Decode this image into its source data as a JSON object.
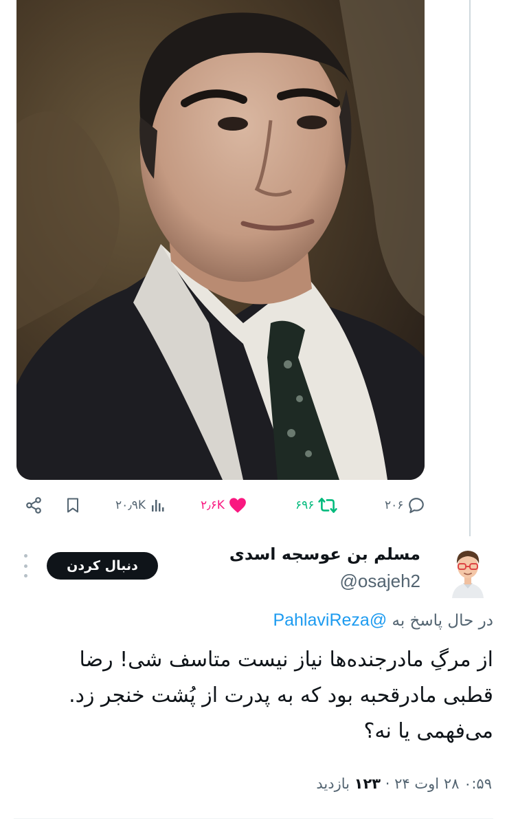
{
  "media": {
    "photo_icon": "portrait-photo"
  },
  "actions": {
    "reply_count": "۲۰۶",
    "retweet_count": "۶۹۶",
    "like_count": "۲٫۶K",
    "views_count": "۲۰٫۹K",
    "icons": [
      "reply-icon",
      "retweet-icon",
      "heart-icon",
      "views-icon",
      "bookmark-icon",
      "share-icon"
    ],
    "colors": {
      "default": "#536471",
      "like": "#f91880",
      "retweet": "#00ba7c"
    }
  },
  "reply": {
    "display_name": "مسلم بن عوسجه اسدی",
    "handle": "@osajeh2",
    "follow_label": "دنبال کردن",
    "replying_prefix": "در حال پاسخ به",
    "replying_to": "@PahlaviReza",
    "text_lines": [
      "از مرگِ مادرجنده‌ها نیاز نیست متاسف شی! رضا",
      "قطبی مادرقحبه بود که به پدرت از پُشت خنجر زد.",
      "می‌فهمی یا نه؟"
    ],
    "timestamp": "۰:۵۹ ۲۸ اوت ۲۴",
    "separator": "·",
    "views_number": "۱۲۳",
    "views_label": "بازدید"
  },
  "colors": {
    "link": "#1d9bf0",
    "text": "#0f1419",
    "secondary": "#536471",
    "follow_button": "#0f1419"
  }
}
